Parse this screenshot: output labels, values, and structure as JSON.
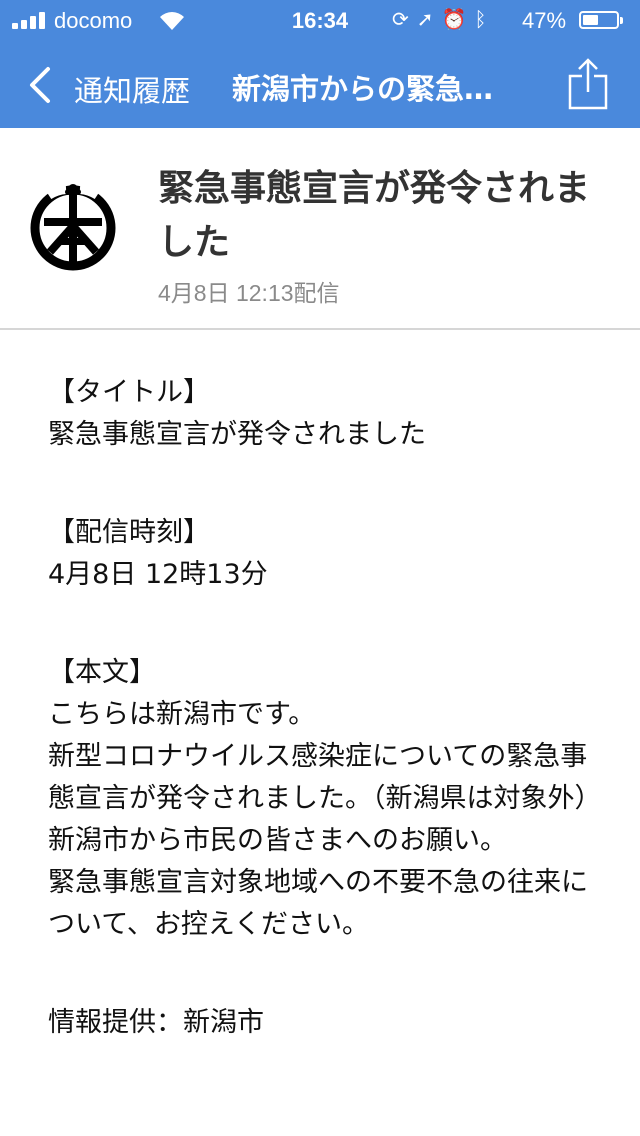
{
  "status_bar": {
    "carrier": "docomo",
    "time": "16:34",
    "battery_percent": "47%",
    "battery_level": 0.47,
    "icons": [
      "orientation-lock-icon",
      "location-arrow-icon",
      "alarm-icon",
      "bluetooth-icon"
    ]
  },
  "nav": {
    "back_label": "通知履歴",
    "title": "新潟市からの緊急…",
    "share_icon": "share-icon"
  },
  "message": {
    "title": "緊急事態宣言が発令されました",
    "date": "4月8日 12:13配信",
    "sender_logo": "niigata-city-emblem-icon"
  },
  "body": {
    "title_label": "【タイトル】",
    "title_value": "緊急事態宣言が発令されました",
    "time_label": "【配信時刻】",
    "time_value": "4月8日 12時13分",
    "text_label": "【本文】",
    "paragraphs": [
      "こちらは新潟市です。",
      "新型コロナウイルス感染症についての緊急事態宣言が発令されました。（新潟県は対象外）",
      "新潟市から市民の皆さまへのお願い。",
      "緊急事態宣言対象地域への不要不急の往来について、お控えください。"
    ],
    "source": "情報提供：新潟市"
  },
  "colors": {
    "bar": "#4a89dc",
    "title_text": "#333333",
    "date_text": "#8a8a8a",
    "divider": "#d6d6d6"
  }
}
